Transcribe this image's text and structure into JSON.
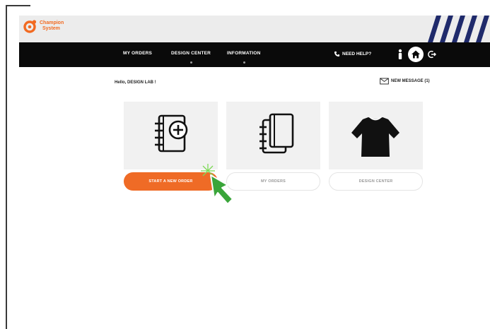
{
  "brand": {
    "line1": "Champion",
    "line2": "System",
    "color": "#f26a21"
  },
  "nav": {
    "items": [
      {
        "label": "MY ORDERS"
      },
      {
        "label": "DESIGN CENTER"
      },
      {
        "label": "INFORMATION"
      }
    ],
    "help_label": "NEED HELP?"
  },
  "greeting": "Hello, DESIGN LAB !",
  "new_message": "NEW MESSAGE (1)",
  "actions": [
    {
      "label": "START A NEW ORDER",
      "state": "highlighted"
    },
    {
      "label": "MY ORDERS"
    },
    {
      "label": "DESIGN CENTER"
    }
  ],
  "colors": {
    "accent": "#ef6b26",
    "navbar": "#0a0a0a",
    "pointer": "#3aa53a",
    "stripes": "#1f2a6b"
  },
  "icons": [
    "new-order-icon",
    "orders-icon",
    "jersey-icon",
    "phone-icon",
    "user-icon",
    "home-icon",
    "logout-icon",
    "envelope-icon",
    "cursor-arrow-icon"
  ]
}
